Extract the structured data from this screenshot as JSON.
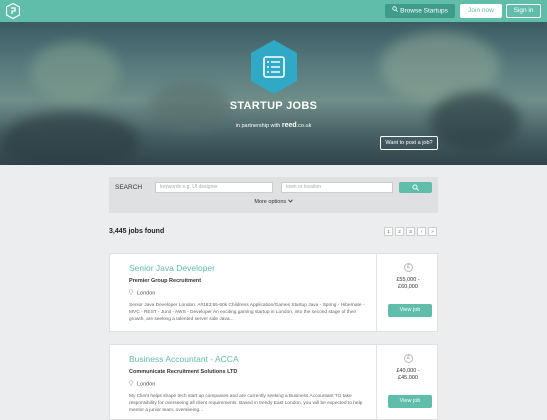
{
  "nav": {
    "browse_label": "Browse Startups",
    "join_label": "Join now",
    "signin_label": "Sign in"
  },
  "hero": {
    "title": "STARTUP JOBS",
    "partner_prefix": "in partnership with",
    "partner_brand": "reed",
    "partner_suffix": ".co.uk",
    "post_job_label": "Want to post a job?"
  },
  "search": {
    "label": "SEARCH",
    "keyword_placeholder": "keywords e.g. UI designer",
    "location_placeholder": "town or location",
    "more_options_label": "More options"
  },
  "results": {
    "count_text": "3,445 jobs found",
    "pages": [
      "1",
      "2",
      "3",
      "›",
      "»"
    ]
  },
  "jobs": [
    {
      "title": "Senior Java Developer",
      "company": "Premier Group Recruitment",
      "location": "London",
      "description": "Senior Java Developer London. A#163;55-60k Childrens Application/Games Startup Java - Spring - Hibernate - MVC - REST - Junit - AWS - Developer An exciting gaming startup in London, into the second stage of their growth, are seeking a talented server side Java...",
      "salary_from": "£55,000 -",
      "salary_to": "£60,000",
      "view_label": "View job"
    },
    {
      "title": "Business Accountant - ACCA",
      "company": "Communicate Recruitment Solutions LTD",
      "location": "London",
      "description": "My Client helps shape tech start up companies and are currently seeking a Business Accountant TO take responsibility for overseeing all client requirements. Based in trendy East London, you will be expected to help mentor a junior team, overseeing...",
      "salary_from": "£40,000 -",
      "salary_to": "£45,000",
      "view_label": "View job"
    }
  ],
  "colors": {
    "accent": "#5fbdaa",
    "accent_dark": "#3f9c8a",
    "page_bg": "#ecedef"
  }
}
